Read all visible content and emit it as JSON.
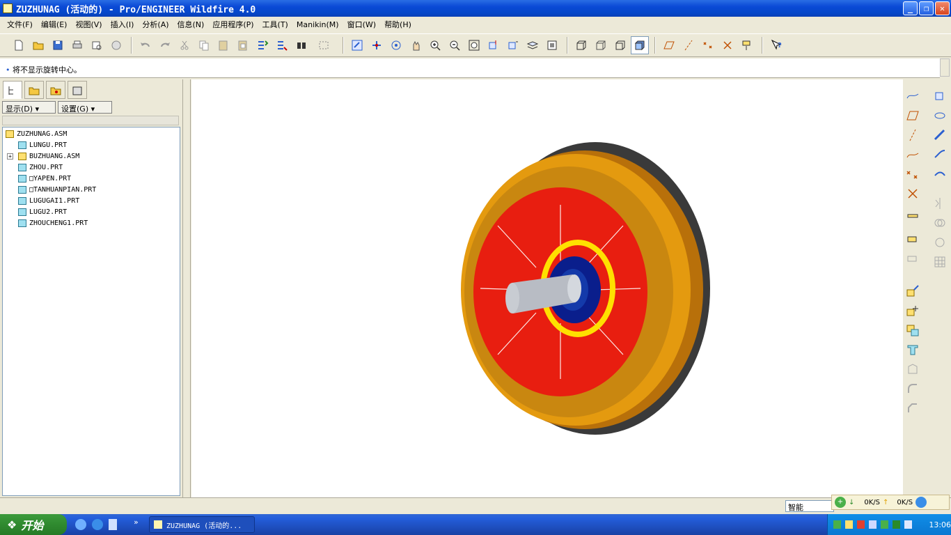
{
  "window": {
    "title": "ZUZHUNAG (活动的) - Pro/ENGINEER Wildfire 4.0",
    "minimize_glyph": "_",
    "restore_glyph": "❐",
    "close_glyph": "✕"
  },
  "menu": [
    "文件(F)",
    "编辑(E)",
    "视图(V)",
    "插入(I)",
    "分析(A)",
    "信息(N)",
    "应用程序(P)",
    "工具(T)",
    "Manikin(M)",
    "窗口(W)",
    "帮助(H)"
  ],
  "message": {
    "bullet": "•",
    "text": "将不显示旋转中心。"
  },
  "panel": {
    "show_label": "显示(D)",
    "settings_label": "设置(G)",
    "tree": [
      {
        "name": "ZUZHUNAG.ASM",
        "type": "asm",
        "level": 0
      },
      {
        "name": "LUNGU.PRT",
        "type": "prt",
        "level": 1
      },
      {
        "name": "BUZHUANG.ASM",
        "type": "asm",
        "level": 1,
        "expander": "+"
      },
      {
        "name": "ZHOU.PRT",
        "type": "prt",
        "level": 1
      },
      {
        "name": "□YAPEN.PRT",
        "type": "prt",
        "level": 1
      },
      {
        "name": "□TANHUANPIAN.PRT",
        "type": "prt",
        "level": 1
      },
      {
        "name": "LUGUGAI1.PRT",
        "type": "prt",
        "level": 1
      },
      {
        "name": "LUGU2.PRT",
        "type": "prt",
        "level": 1
      },
      {
        "name": "ZHOUCHENG1.PRT",
        "type": "prt",
        "level": 1
      }
    ]
  },
  "status": {
    "filter_value": "智能"
  },
  "netmon": {
    "down": "0K/S",
    "up": "0K/S"
  },
  "taskbar": {
    "start_label": "开始",
    "task_label": "ZUZHUNAG (活动的...",
    "clock": "13:06"
  },
  "colors": {
    "housing": "#e49a0f",
    "disc": "#e81e10",
    "ring": "#ffe000",
    "hub": "#0a1e8c",
    "shaft": "#b8bcc4",
    "flywheel": "#3a3a3a"
  }
}
